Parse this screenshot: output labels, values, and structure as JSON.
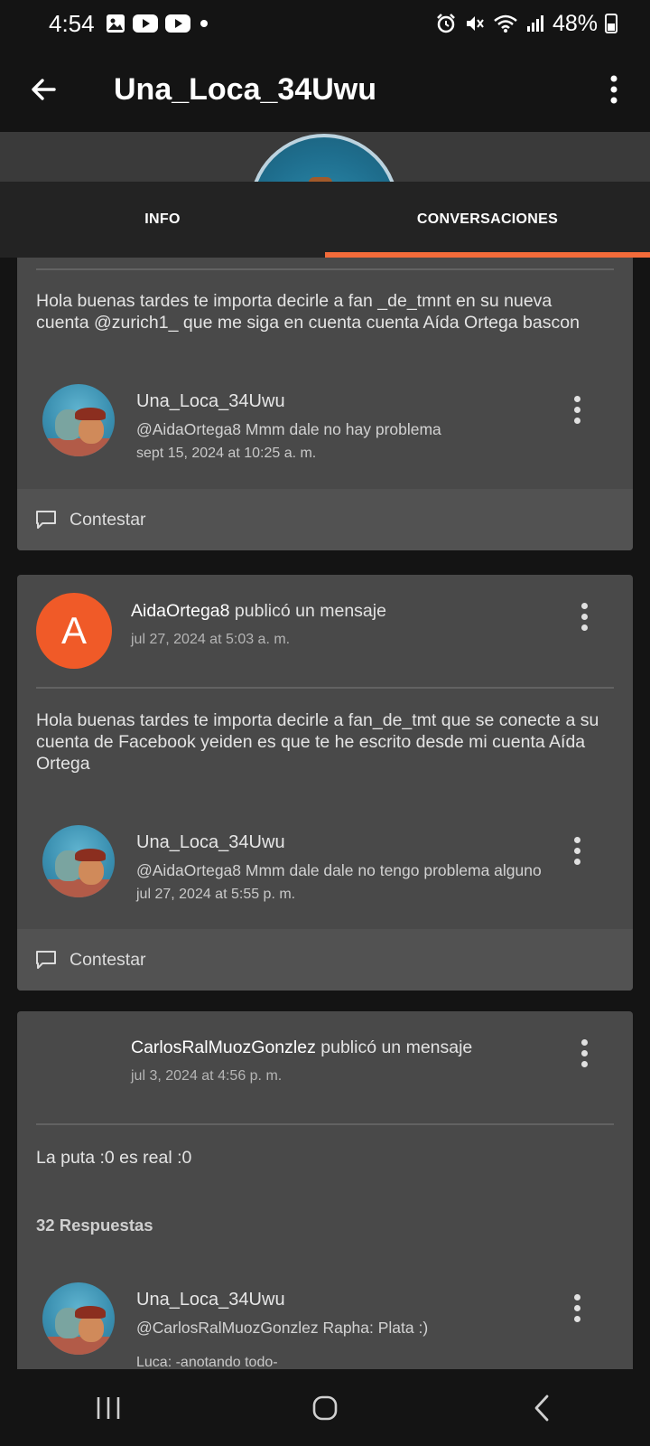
{
  "status_bar": {
    "time": "4:54",
    "battery": "48%",
    "left_icons": [
      "image-icon",
      "youtube-icon",
      "youtube-icon",
      "dot-icon"
    ],
    "right_icons": [
      "alarm-icon",
      "mute-icon",
      "wifi-icon",
      "signal-icon",
      "battery-icon"
    ]
  },
  "app_bar": {
    "title": "Una_Loca_34Uwu",
    "back_icon": "arrow-left-icon",
    "menu_icon": "more-vertical-icon"
  },
  "tabs": [
    {
      "label": "INFO",
      "active": false
    },
    {
      "label": "CONVERSACIONES",
      "active": true
    }
  ],
  "accent_color": "#f26b3a",
  "posts": [
    {
      "message": "Hola buenas tardes te importa decirle a fan _de_tmnt en su nueva cuenta @zurich1_ que me siga en cuenta cuenta Aída Ortega bascon",
      "reply": {
        "user": "Una_Loca_34Uwu",
        "text": "@AidaOrtega8 Mmm dale no hay problema",
        "date": "sept 15, 2024 at 10:25 a. m."
      },
      "action_label": "Contestar"
    },
    {
      "avatar_letter": "A",
      "author": "AidaOrtega8",
      "action": "publicó un mensaje",
      "date": "jul 27, 2024 at 5:03 a. m.",
      "message": "Hola buenas tardes te importa decirle a fan_de_tmt que se conecte a su cuenta de Facebook yeiden es que te he escrito desde mi cuenta Aída Ortega",
      "reply": {
        "user": "Una_Loca_34Uwu",
        "text": "@AidaOrtega8 Mmm dale dale no tengo problema alguno",
        "date": "jul 27, 2024 at 5:55 p. m."
      },
      "action_label": "Contestar"
    },
    {
      "author": "CarlosRalMuozGonzlez",
      "action": "publicó un mensaje",
      "date": "jul 3, 2024 at 4:56 p. m.",
      "message": "La puta :0 es real :0",
      "responses": "32 Respuestas",
      "reply": {
        "user": "Una_Loca_34Uwu",
        "text": "@CarlosRalMuozGonzlez Rapha: Plata :)",
        "extra": "Luca: -anotando todo-"
      }
    }
  ],
  "nav": [
    "recents-icon",
    "home-icon",
    "back-icon"
  ]
}
